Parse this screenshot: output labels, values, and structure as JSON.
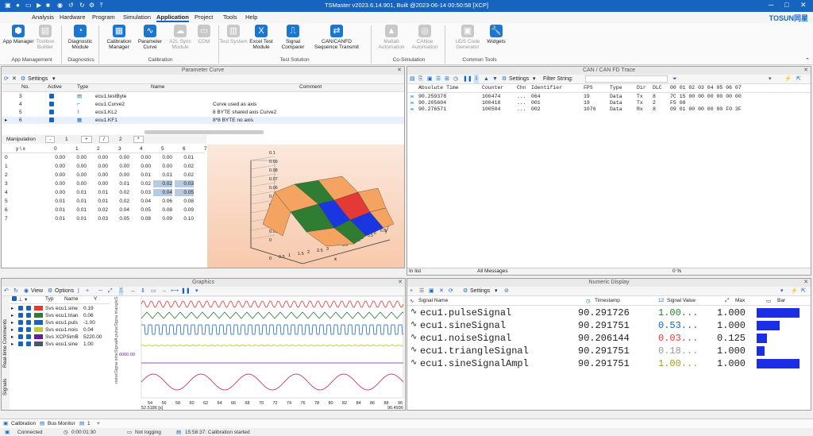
{
  "title": "TSMaster v2023.6.14.901, Built @2023-06-14 00:50:58 [XCP]",
  "menu": [
    "Analysis",
    "Hardware",
    "Program",
    "Simulation",
    "Application",
    "Project",
    "Tools",
    "Help"
  ],
  "brand": "TOSUN同星",
  "ribbon": {
    "buttons": [
      "App Manager",
      "Toolbox Builder",
      "Diagnostic Module",
      "Calibration Manager",
      "Parameter Curve",
      "A2L Sync Module",
      "CDM",
      "Test System",
      "Excel Test Module",
      "Signal Comparer",
      "CAN/CANFD Sequence Transmit",
      "Matlab Automation",
      "CANoe Automation",
      "UDS Code Generator",
      "Widgets"
    ],
    "groups": [
      "App Management",
      "Diagnostics",
      "Calibration",
      "Test Solution",
      "Co-Simulation",
      "Common Tools"
    ]
  },
  "param": {
    "title": "Parameter Curve",
    "settings": "Settings",
    "headers": [
      "No.",
      "Active",
      "Type",
      "Name",
      "Comment"
    ],
    "rows": [
      {
        "no": "3",
        "name": "ecu1.testByte",
        "comment": ""
      },
      {
        "no": "4",
        "name": "ecu1.Curve2",
        "comment": "Curve used as axis"
      },
      {
        "no": "5",
        "name": "ecu1.KL2",
        "comment": "8 BYTE shared axis Curve2"
      },
      {
        "no": "6",
        "name": "ecu1.KF1",
        "comment": "8*8 BYTE no axis"
      }
    ],
    "manip": {
      "label": "Manipulation",
      "minus": "-",
      "v1": "1",
      "plus": "+",
      "div": "/",
      "v2": "2",
      "mul": "*"
    },
    "corner": "y \\ x",
    "cols": [
      "0",
      "1",
      "2",
      "3",
      "4",
      "5",
      "6",
      "7"
    ],
    "grid": [
      [
        "0.00",
        "0.00",
        "0.00",
        "0.00",
        "0.00",
        "0.00",
        "0.01"
      ],
      [
        "0.00",
        "0.00",
        "0.00",
        "0.00",
        "0.00",
        "0.00",
        "0.02"
      ],
      [
        "0.00",
        "0.00",
        "0.00",
        "0.00",
        "0.01",
        "0.01",
        "0.02"
      ],
      [
        "0.00",
        "0.00",
        "0.00",
        "0.01",
        "0.02",
        "0.02",
        "0.03"
      ],
      [
        "0.00",
        "0.01",
        "0.01",
        "0.02",
        "0.03",
        "0.04",
        "0.05"
      ],
      [
        "0.01",
        "0.01",
        "0.01",
        "0.02",
        "0.04",
        "0.06",
        "0.08"
      ],
      [
        "0.01",
        "0.01",
        "0.02",
        "0.04",
        "0.05",
        "0.08",
        "0.09"
      ],
      [
        "0.01",
        "0.01",
        "0.03",
        "0.05",
        "0.08",
        "0.09",
        "0.10"
      ]
    ],
    "zaxis": [
      "0.1",
      "0.09",
      "0.08",
      "0.07",
      "0.06",
      "0.05",
      "0.04",
      "0.03",
      "0.02",
      "0.01",
      "0"
    ],
    "xaxis": [
      "0",
      "0.5",
      "1",
      "1.5",
      "2",
      "2.5",
      "3"
    ],
    "yaxis": [
      "3.5",
      "4",
      "4.5",
      "5",
      "5.5",
      "6",
      "6.5",
      "7"
    ],
    "xl": "x",
    "yl": "y"
  },
  "trace": {
    "title": "CAN / CAN FD Trace",
    "settings": "Settings",
    "filter": "Filter String:",
    "headers": [
      "Absolute Time",
      "Counter",
      "Chn",
      "Identifier",
      "FPS",
      "Type",
      "Dir",
      "DLC",
      "00 01 02 03 04 05 06 07"
    ],
    "rows": [
      [
        "90.259378",
        "100474",
        "...",
        "064",
        "19",
        "Data",
        "Tx",
        "8",
        "7C 15 00 00 00 00 00 00"
      ],
      [
        "90.205604",
        "100418",
        "...",
        "001",
        "19",
        "Data",
        "Tx",
        "2",
        "F5 08"
      ],
      [
        "90.276571",
        "100504",
        "...",
        "002",
        "1076",
        "Data",
        "Rx",
        "8",
        "09 01 00 00 00 00 F0 3F"
      ]
    ],
    "inlist": "In list",
    "allmsg": "All Messages",
    "pct": "0 %"
  },
  "graphics": {
    "title": "Graphics",
    "view": "View",
    "options": "Options",
    "headers": [
      "Typ",
      "Name",
      "Y"
    ],
    "rows": [
      {
        "t": "Svs",
        "n": "ecu1.sine",
        "y": "0.19",
        "c": "#e53935"
      },
      {
        "t": "Svs",
        "n": "ecu1.trian",
        "y": "0.06",
        "c": "#2e7d32"
      },
      {
        "t": "Svs",
        "n": "ecu1.puls",
        "y": "-1.00",
        "c": "#1565c0"
      },
      {
        "t": "Svs",
        "n": "ecu1.nois",
        "y": "0.04",
        "c": "#c0ca33"
      },
      {
        "t": "Svs",
        "n": "XCPSimB",
        "y": "5220.00",
        "c": "#6a1b9a"
      },
      {
        "t": "Svs",
        "n": "ecu1.sine",
        "y": "1.00",
        "c": "#455a64"
      }
    ],
    "side": [
      "Real-time Comments",
      "Signals"
    ],
    "xticks": [
      "54",
      "56",
      "58",
      "60",
      "62",
      "64",
      "66",
      "68",
      "70",
      "72",
      "74",
      "76",
      "78",
      "80",
      "82",
      "84",
      "86",
      "88",
      "90"
    ],
    "xstart": "52.5186 [s]",
    "xend": "90.4936",
    "ytick": "6000.00",
    "ylabel": "noiseSigna sineSignalA pulseSigna triangleS sineSi"
  },
  "numeric": {
    "title": "Numeric Display",
    "settings": "Settings",
    "headers": [
      "Signal Name",
      "Timestamp",
      "Signal Value",
      "Max",
      "Bar"
    ],
    "rows": [
      {
        "n": "ecu1.pulseSignal",
        "t": "90.291726",
        "v": "1.00...",
        "m": "1.000",
        "bar": 1.0,
        "c": "#2e7d32"
      },
      {
        "n": "ecu1.sineSignal",
        "t": "90.291751",
        "v": "0.53...",
        "m": "1.000",
        "bar": 0.53,
        "c": "#1565c0"
      },
      {
        "n": "ecu1.noiseSignal",
        "t": "90.206144",
        "v": "0.03...",
        "m": "0.125",
        "bar": 0.24,
        "c": "#e53935"
      },
      {
        "n": "ecu1.triangleSignal",
        "t": "90.291751",
        "v": "0.18...",
        "m": "1.000",
        "bar": 0.18,
        "c": "#999999"
      },
      {
        "n": "ecu1.sineSignalAmpl",
        "t": "90.291751",
        "v": "1.00...",
        "m": "1.000",
        "bar": 1.0,
        "c": "#9e9d24"
      }
    ]
  },
  "bottomtabs": [
    "Calibration",
    "Bus Monitor",
    "1"
  ],
  "status": {
    "conn": "Connected",
    "time": "0:00:01:30",
    "log": "Not logging",
    "msg": "15:58:37: Calibration started"
  }
}
